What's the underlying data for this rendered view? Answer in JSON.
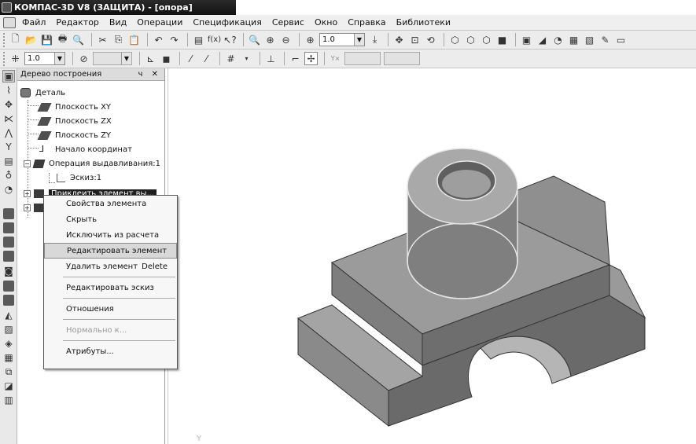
{
  "window": {
    "title": "КОМПАС-3D V8 (ЗАЩИТА) - [опора]"
  },
  "menu": {
    "items": [
      "Файл",
      "Редактор",
      "Вид",
      "Операции",
      "Спецификация",
      "Сервис",
      "Окно",
      "Справка",
      "Библиотеки"
    ]
  },
  "toolbar1": {
    "zoom_value": "1.0"
  },
  "toolbar2": {
    "scale_value": "1.0"
  },
  "tree": {
    "panel_title": "Дерево построения",
    "panel_controls": "ч ✕",
    "root": "Деталь",
    "items": [
      "Плоскость XY",
      "Плоскость ZX",
      "Плоскость ZY",
      "Начало координат",
      "Операция выдавливания:1",
      "Эскиз:1",
      "Приклеить элемент вы..."
    ]
  },
  "context_menu": {
    "items": [
      {
        "label": "Свойства элемента",
        "state": "normal"
      },
      {
        "label": "Скрыть",
        "state": "normal"
      },
      {
        "label": "Исключить из расчета",
        "state": "normal"
      },
      {
        "label": "Редактировать элемент",
        "state": "highlighted"
      },
      {
        "label": "Удалить элемент",
        "shortcut": "Delete",
        "state": "normal"
      },
      {
        "label": "Редактировать эскиз",
        "state": "normal"
      },
      {
        "label": "Отношения",
        "state": "normal"
      },
      {
        "label": "Нормально к...",
        "state": "disabled"
      },
      {
        "label": "Атрибуты...",
        "state": "normal"
      }
    ]
  },
  "viewport": {
    "axis_label": "Y"
  },
  "colors": {
    "part_dark": "#5a5a5a",
    "part_mid": "#8a8a8a",
    "part_light": "#a8a8a8",
    "highlight": "#d8d8d8"
  }
}
